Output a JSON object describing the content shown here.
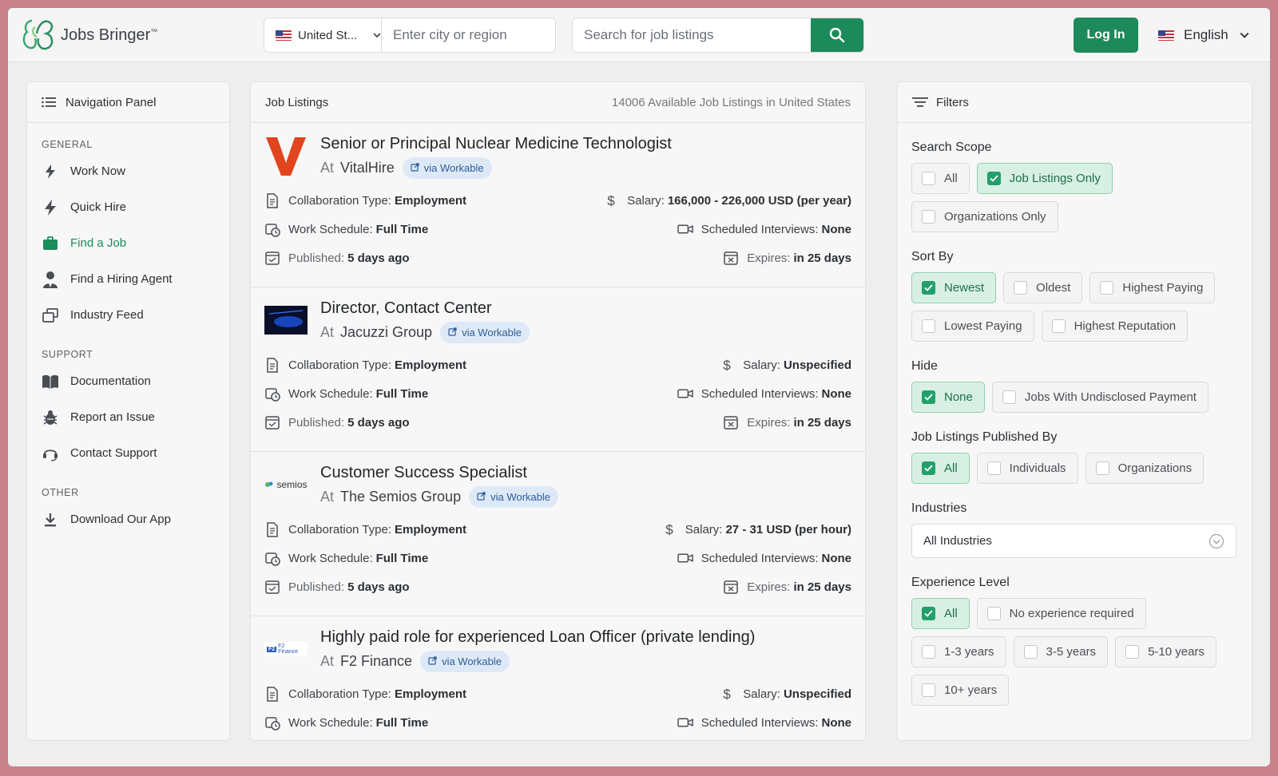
{
  "brand": {
    "name": "Jobs Bringer",
    "tm": "™"
  },
  "header": {
    "country": "United St...",
    "city_placeholder": "Enter city or region",
    "search_placeholder": "Search for job listings",
    "login_label": "Log In",
    "language": "English"
  },
  "nav": {
    "title": "Navigation Panel",
    "sections": [
      {
        "title": "GENERAL",
        "items": [
          {
            "label": "Work Now",
            "icon": "bolt-icon"
          },
          {
            "label": "Quick Hire",
            "icon": "lightning-icon"
          },
          {
            "label": "Find a Job",
            "icon": "briefcase-icon",
            "active": true
          },
          {
            "label": "Find a Hiring Agent",
            "icon": "agent-icon"
          },
          {
            "label": "Industry Feed",
            "icon": "feed-icon"
          }
        ]
      },
      {
        "title": "SUPPORT",
        "items": [
          {
            "label": "Documentation",
            "icon": "book-icon"
          },
          {
            "label": "Report an Issue",
            "icon": "bug-icon"
          },
          {
            "label": "Contact Support",
            "icon": "headset-icon"
          }
        ]
      },
      {
        "title": "OTHER",
        "items": [
          {
            "label": "Download Our App",
            "icon": "download-icon"
          }
        ]
      }
    ]
  },
  "listings": {
    "title": "Job Listings",
    "count_text": "14006 Available Job Listings in United States",
    "labels": {
      "at": "At",
      "collab": "Collaboration Type:",
      "salary": "Salary:",
      "schedule": "Work Schedule:",
      "interviews": "Scheduled Interviews:",
      "published": "Published:",
      "expires": "Expires:"
    },
    "jobs": [
      {
        "title": "Senior or Principal Nuclear Medicine Technologist",
        "company": "VitalHire",
        "via": "via Workable",
        "collab": "Employment",
        "salary": "166,000 - 226,000 USD (per year)",
        "schedule": "Full Time",
        "interviews": "None",
        "published": "5 days ago",
        "expires": "in 25 days",
        "logo": "vitalhire-logo"
      },
      {
        "title": "Director, Contact Center",
        "company": "Jacuzzi Group",
        "via": "via Workable",
        "collab": "Employment",
        "salary": "Unspecified",
        "schedule": "Full Time",
        "interviews": "None",
        "published": "5 days ago",
        "expires": "in 25 days",
        "logo": "jacuzzi-logo"
      },
      {
        "title": "Customer Success Specialist",
        "company": "The Semios Group",
        "via": "via Workable",
        "collab": "Employment",
        "salary": "27 - 31 USD (per hour)",
        "schedule": "Full Time",
        "interviews": "None",
        "published": "5 days ago",
        "expires": "in 25 days",
        "logo": "semios-logo",
        "logo_text": "semios"
      },
      {
        "title": "Highly paid role for experienced Loan Officer (private lending)",
        "company": "F2 Finance",
        "via": "via Workable",
        "collab": "Employment",
        "salary": "Unspecified",
        "schedule": "Full Time",
        "interviews": "None",
        "logo": "f2-finance-logo",
        "logo_text": "F2 Finance"
      }
    ]
  },
  "filters": {
    "title": "Filters",
    "groups": [
      {
        "title": "Search Scope",
        "options": [
          {
            "label": "All",
            "on": false
          },
          {
            "label": "Job Listings Only",
            "on": true
          },
          {
            "label": "Organizations Only",
            "on": false
          }
        ]
      },
      {
        "title": "Sort By",
        "options": [
          {
            "label": "Newest",
            "on": true
          },
          {
            "label": "Oldest",
            "on": false
          },
          {
            "label": "Highest Paying",
            "on": false
          },
          {
            "label": "Lowest Paying",
            "on": false
          },
          {
            "label": "Highest Reputation",
            "on": false
          }
        ]
      },
      {
        "title": "Hide",
        "options": [
          {
            "label": "None",
            "on": true
          },
          {
            "label": "Jobs With Undisclosed Payment",
            "on": false
          }
        ]
      },
      {
        "title": "Job Listings Published By",
        "options": [
          {
            "label": "All",
            "on": true
          },
          {
            "label": "Individuals",
            "on": false
          },
          {
            "label": "Organizations",
            "on": false
          }
        ]
      }
    ],
    "industries": {
      "title": "Industries",
      "value": "All Industries"
    },
    "experience": {
      "title": "Experience Level",
      "options": [
        {
          "label": "All",
          "on": true
        },
        {
          "label": "No experience required",
          "on": false
        },
        {
          "label": "1-3 years",
          "on": false
        },
        {
          "label": "3-5 years",
          "on": false
        },
        {
          "label": "5-10 years",
          "on": false
        },
        {
          "label": "10+ years",
          "on": false
        }
      ]
    }
  },
  "colors": {
    "accent": "#1c8a5a",
    "background": "#c98289"
  }
}
